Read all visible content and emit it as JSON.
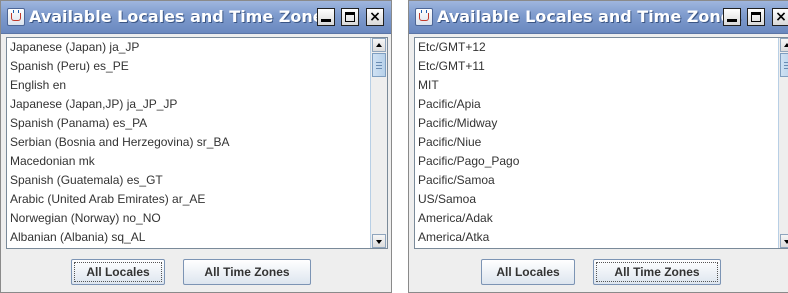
{
  "windows": [
    {
      "title": "Available Locales and Time Zones",
      "controls": {
        "close": "×"
      },
      "items": [
        "Japanese (Japan) ja_JP",
        "Spanish (Peru) es_PE",
        "English en",
        "Japanese (Japan,JP) ja_JP_JP",
        "Spanish (Panama) es_PA",
        "Serbian (Bosnia and Herzegovina) sr_BA",
        "Macedonian mk",
        "Spanish (Guatemala) es_GT",
        "Arabic (United Arab Emirates) ar_AE",
        "Norwegian (Norway) no_NO",
        "Albanian (Albania) sq_AL"
      ],
      "buttons": {
        "locales": "All Locales",
        "time_zones": "All Time Zones"
      }
    },
    {
      "title": "Available Locales and Time Zones",
      "controls": {
        "close": "×"
      },
      "items": [
        "Etc/GMT+12",
        "Etc/GMT+11",
        "MIT",
        "Pacific/Apia",
        "Pacific/Midway",
        "Pacific/Niue",
        "Pacific/Pago_Pago",
        "Pacific/Samoa",
        "US/Samoa",
        "America/Adak",
        "America/Atka"
      ],
      "buttons": {
        "locales": "All Locales",
        "time_zones": "All Time Zones"
      }
    }
  ],
  "colors": {
    "titlebar": "#7e9bcd",
    "title_text": "#ffffff",
    "window_bg": "#eeeeee",
    "list_text": "#333333",
    "scroll_thumb": "#b7d1ea"
  },
  "icons": {
    "app": "java-cup-icon",
    "minimize": "minimize-icon",
    "maximize": "maximize-icon",
    "close": "close-icon",
    "scroll_up": "arrow-up-icon",
    "scroll_down": "arrow-down-icon"
  }
}
